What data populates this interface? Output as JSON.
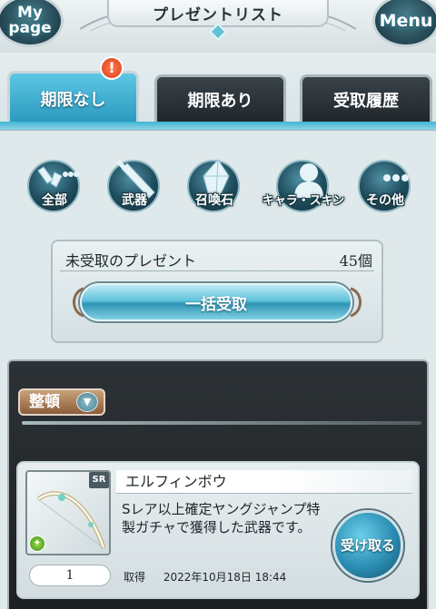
{
  "header": {
    "title": "プレゼントリスト",
    "mypage_line1": "My",
    "mypage_line2": "page",
    "menu_label": "Menu"
  },
  "tabs": [
    {
      "label": "期限なし",
      "active": true,
      "alert": "!"
    },
    {
      "label": "期限あり",
      "active": false
    },
    {
      "label": "受取履歴",
      "active": false
    }
  ],
  "categories": [
    {
      "label": "全部",
      "icon": "all-items-icon"
    },
    {
      "label": "武器",
      "icon": "sword-icon"
    },
    {
      "label": "召喚石",
      "icon": "summon-crystal-icon"
    },
    {
      "label": "キャラ・スキン",
      "icon": "character-silhouette-icon"
    },
    {
      "label": "その他",
      "icon": "more-dots-icon"
    }
  ],
  "unreceived": {
    "label": "未受取のプレゼント",
    "count": "45個",
    "bulk_button": "一括受取"
  },
  "sort": {
    "label": "整頓"
  },
  "item": {
    "name": "エルフィンボウ",
    "rarity": "SR",
    "description": "Sレア以上確定ヤングジャンプ特製ガチャで獲得した武器です。",
    "quantity": "1",
    "acquired_label": "取得",
    "acquired_date": "2022年10月18日 18:44",
    "receive_button": "受け取る"
  },
  "colors": {
    "accent": "#3fb6d6",
    "tab_inactive": "#20272c",
    "panel_dark": "#23282b",
    "sort_button": "#a87d58"
  }
}
